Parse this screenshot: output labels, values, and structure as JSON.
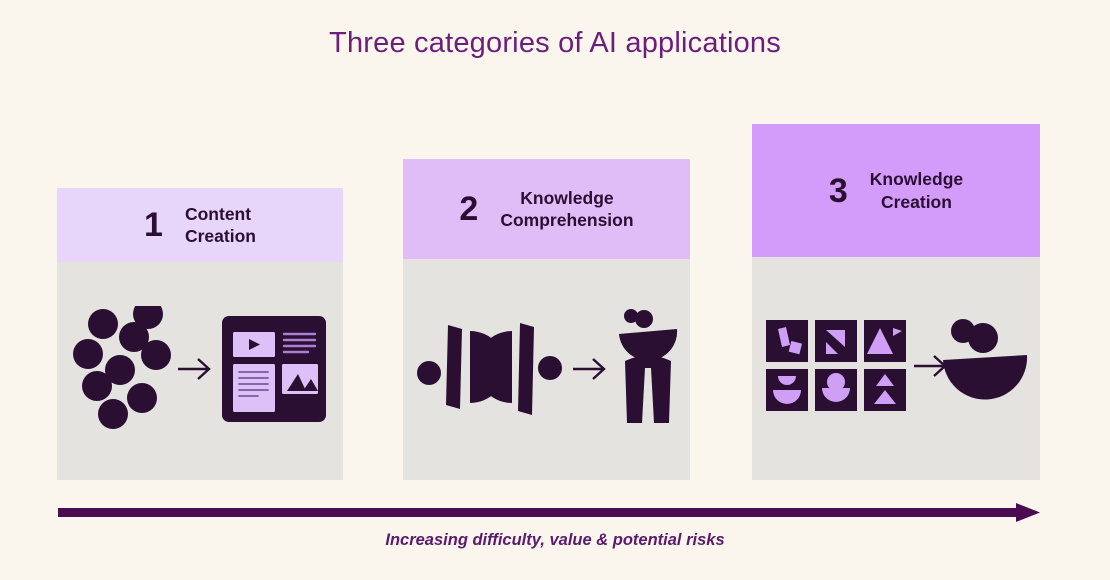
{
  "title": "Three categories of AI applications",
  "colors": {
    "background": "#faf6ed",
    "title_purple": "#6b1f7a",
    "dark_plum": "#2a0f33",
    "card1_header": "#e8d5fa",
    "card2_header": "#e0bdf7",
    "card3_header": "#d49cfa",
    "card_body_gray": "#e4e3e0",
    "accent_light_purple": "#cf9ef5",
    "arrow_purple": "#4a0d52"
  },
  "cards": [
    {
      "number": "1",
      "label": "Content\nCreation",
      "icon_left": "data-points-cluster-icon",
      "icon_arrow": "arrow-right-icon",
      "icon_right": "media-layout-panel-icon"
    },
    {
      "number": "2",
      "label": "Knowledge\nComprehension",
      "icon_left": "abstract-shapes-row-icon",
      "icon_arrow": "arrow-right-icon",
      "icon_right": "human-figure-icon"
    },
    {
      "number": "3",
      "label": "Knowledge\nCreation",
      "icon_left": "shape-tiles-grid-icon",
      "icon_arrow": "arrow-right-icon",
      "icon_right": "composed-form-icon"
    }
  ],
  "axis": {
    "caption": "Increasing difficulty, value & potential risks",
    "icon": "long-arrow-right-icon"
  }
}
